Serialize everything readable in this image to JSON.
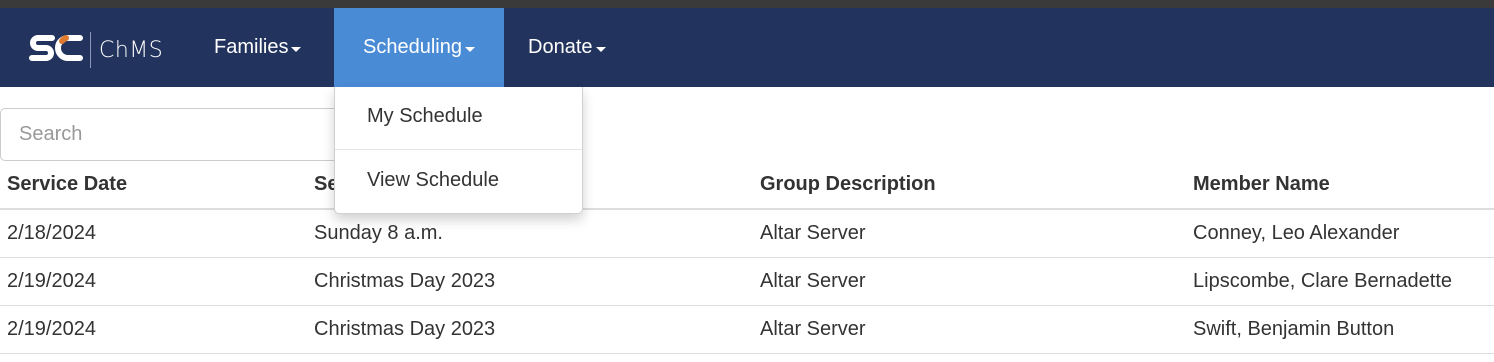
{
  "brand": {
    "logo_text": "SC",
    "name": "ChMS",
    "colors": {
      "navbar": "#22335e",
      "active_tab": "#4a8bd6",
      "logo_accent": "#e07a2e"
    }
  },
  "nav": {
    "families": "Families",
    "scheduling": "Scheduling",
    "donate": "Donate"
  },
  "dropdown": {
    "items": [
      "My Schedule",
      "View Schedule"
    ]
  },
  "search": {
    "placeholder": "Search"
  },
  "table": {
    "headers": [
      "Service Date",
      "Se",
      "Group Description",
      "Member Name"
    ],
    "rows": [
      [
        "2/18/2024",
        "Sunday 8 a.m.",
        "Altar Server",
        "Conney, Leo Alexander"
      ],
      [
        "2/19/2024",
        "Christmas Day 2023",
        "Altar Server",
        "Lipscombe, Clare Bernadette"
      ],
      [
        "2/19/2024",
        "Christmas Day 2023",
        "Altar Server",
        "Swift, Benjamin Button"
      ]
    ]
  }
}
